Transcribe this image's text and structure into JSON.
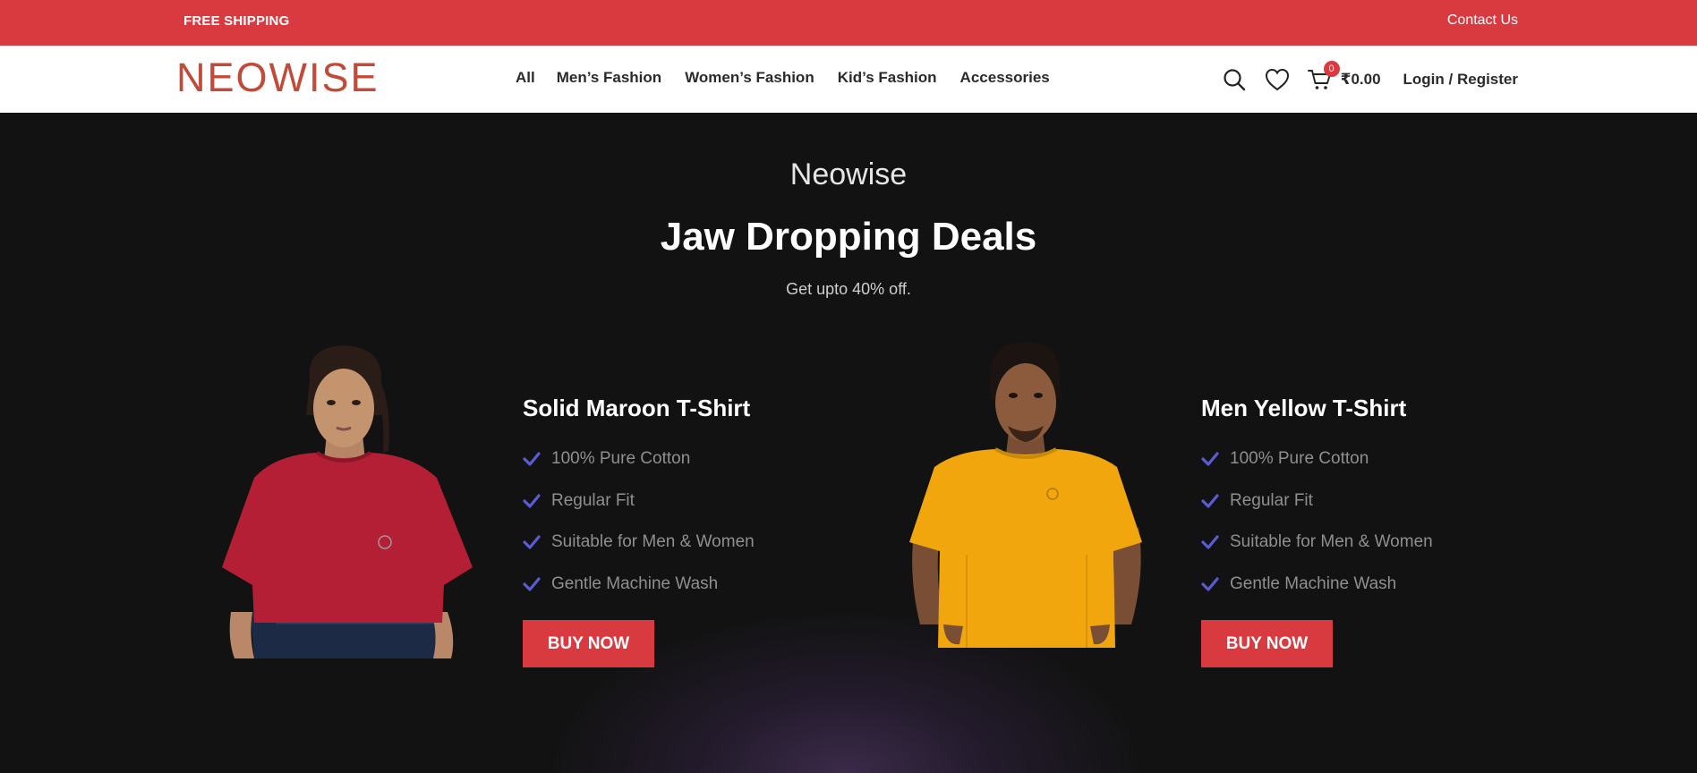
{
  "topbar": {
    "shipping_text": "FREE SHIPPING",
    "contact_label": "Contact Us"
  },
  "header": {
    "logo_text": "NEOWISE",
    "nav_items": [
      "All",
      "Men’s Fashion",
      "Women’s Fashion",
      "Kid’s Fashion",
      "Accessories"
    ],
    "icons": [
      "search-icon",
      "heart-icon",
      "cart-icon"
    ],
    "cart_count": "0",
    "cart_total": "₹0.00",
    "login_label": "Login / Register"
  },
  "hero": {
    "brand": "Neowise",
    "headline": "Jaw Dropping Deals",
    "subheadline": "Get upto 40% off."
  },
  "products": [
    {
      "title": "Solid Maroon T-Shirt",
      "shirt_color": "#b51f35",
      "features": [
        "100% Pure Cotton",
        "Regular Fit",
        "Suitable for Men & Women",
        "Gentle Machine Wash"
      ],
      "cta": "BUY NOW"
    },
    {
      "title": "Men Yellow T-Shirt",
      "shirt_color": "#f0a60c",
      "features": [
        "100% Pure Cotton",
        "Regular Fit",
        "Suitable for Men & Women",
        "Gentle Machine Wash"
      ],
      "cta": "BUY NOW"
    }
  ],
  "colors": {
    "accent": "#d93a3f",
    "logo": "#c24a38",
    "check": "#5b5bd6",
    "hero_bg": "#121212"
  }
}
